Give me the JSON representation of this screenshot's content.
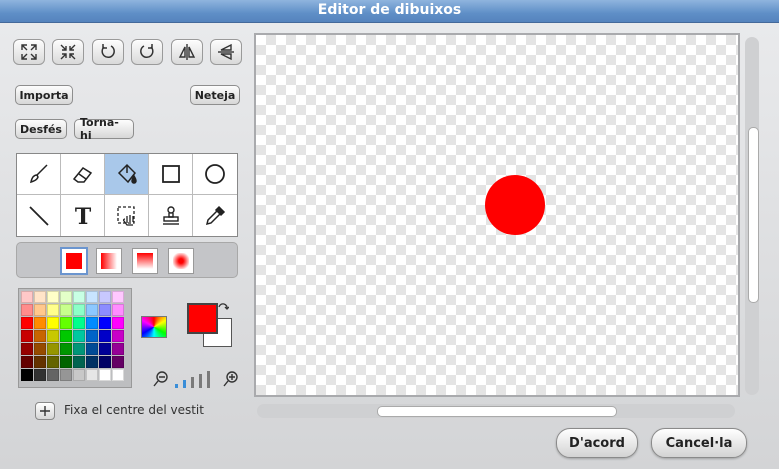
{
  "window": {
    "title": "Editor de dibuixos"
  },
  "top_icons": [
    "grow-icon",
    "shrink-icon",
    "rotate-left-icon",
    "rotate-right-icon",
    "flip-horizontal-icon",
    "flip-vertical-icon"
  ],
  "buttons": {
    "import": "Importa",
    "clear": "Neteja",
    "undo": "Desfés",
    "redo": "Torna-hi",
    "ok": "D'acord",
    "cancel": "Cancel·la"
  },
  "tools": [
    {
      "name": "brush-icon",
      "selected": false
    },
    {
      "name": "eraser-icon",
      "selected": false
    },
    {
      "name": "fill-bucket-icon",
      "selected": true
    },
    {
      "name": "rectangle-icon",
      "selected": false
    },
    {
      "name": "ellipse-icon",
      "selected": false
    },
    {
      "name": "line-icon",
      "selected": false
    },
    {
      "name": "text-icon",
      "selected": false
    },
    {
      "name": "select-icon",
      "selected": false
    },
    {
      "name": "stamp-icon",
      "selected": false
    },
    {
      "name": "eyedropper-icon",
      "selected": false
    }
  ],
  "fill_options": [
    "solid",
    "horizontal-gradient",
    "vertical-gradient",
    "radial-gradient"
  ],
  "colors": {
    "foreground": "#ff0000",
    "background": "#ffffff",
    "palette": [
      "#ffc8c8",
      "#ffe4c8",
      "#ffffc8",
      "#e4ffc8",
      "#c8ffe4",
      "#c8e4ff",
      "#c8c8ff",
      "#ffc8ff",
      "#ff8c8c",
      "#ffc88c",
      "#ffff8c",
      "#c8ff8c",
      "#8cffc8",
      "#8cc8ff",
      "#8c8cff",
      "#ff8cff",
      "#ff0000",
      "#ff8c00",
      "#ffff00",
      "#64ff00",
      "#00ff8c",
      "#008cff",
      "#0000ff",
      "#ff00ff",
      "#c80000",
      "#c86400",
      "#c8c800",
      "#00c800",
      "#00c8a0",
      "#0064c8",
      "#0000c8",
      "#c800c8",
      "#960000",
      "#964b00",
      "#969600",
      "#009600",
      "#009678",
      "#004b96",
      "#000096",
      "#960096",
      "#640000",
      "#643200",
      "#646400",
      "#006400",
      "#006450",
      "#003264",
      "#000064",
      "#640064",
      "#000000",
      "#323232",
      "#646464",
      "#969696",
      "#c8c8c8",
      "#e6e6e6",
      "#ffffff",
      "#ffffff"
    ]
  },
  "zoom": {
    "level": 2
  },
  "set_center": {
    "label": "Fixa el centre del vestit"
  },
  "canvas": {
    "shape": "circle",
    "color": "#ff0000"
  }
}
